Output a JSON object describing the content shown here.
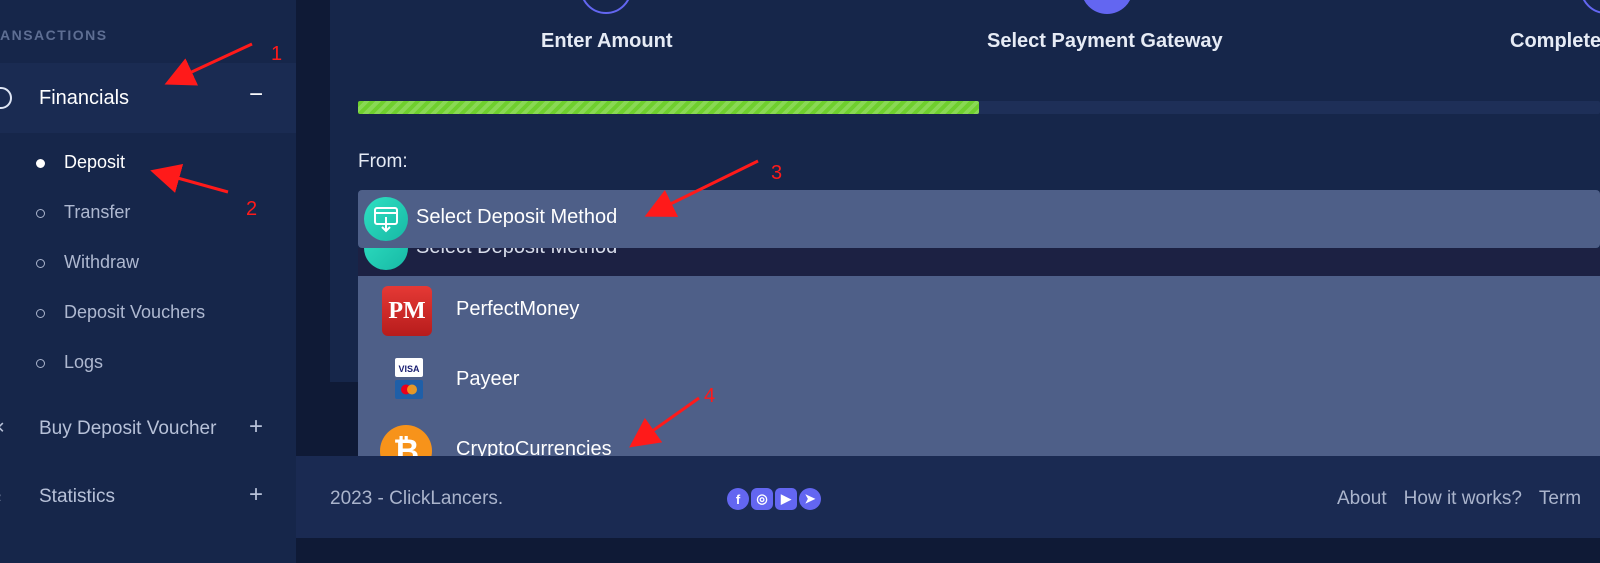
{
  "sidebar": {
    "section_label": "ANSACTIONS",
    "financials": {
      "label": "Financials",
      "toggle": "−"
    },
    "sub_items": [
      {
        "label": "Deposit",
        "active": true
      },
      {
        "label": "Transfer"
      },
      {
        "label": "Withdraw"
      },
      {
        "label": "Deposit Vouchers"
      },
      {
        "label": "Logs"
      }
    ],
    "menu_items": [
      {
        "label": "Buy Deposit Voucher",
        "toggle": "+"
      },
      {
        "label": "Statistics",
        "toggle": "+"
      }
    ]
  },
  "steps": [
    {
      "label": "Enter Amount",
      "state": "done"
    },
    {
      "label": "Select Payment Gateway",
      "state": "active"
    },
    {
      "label": "Complete",
      "state": "pending"
    }
  ],
  "progress": {
    "percent": 50,
    "color": "#6fcf2e"
  },
  "form": {
    "from_label": "From:",
    "select_label": "Select Deposit Method",
    "options": [
      {
        "label": "PerfectMoney",
        "icon": "perfectmoney-icon",
        "icon_text": "PM"
      },
      {
        "label": "Payeer",
        "icon": "visa-mastercard-icon",
        "icon_text": "VISA"
      },
      {
        "label": "CryptoCurrencies",
        "icon": "bitcoin-icon",
        "icon_text": "₿"
      }
    ]
  },
  "footer": {
    "copyright": "2023 - ClickLancers.",
    "socials": [
      "facebook-icon",
      "instagram-icon",
      "youtube-icon",
      "telegram-icon"
    ],
    "links": [
      "About",
      "How it works?",
      "Term"
    ]
  },
  "annotations": [
    "1",
    "2",
    "3",
    "4"
  ],
  "colors": {
    "accent": "#6366f1",
    "annotation": "#ff1a1a",
    "sidebar_bg": "#16264a"
  }
}
